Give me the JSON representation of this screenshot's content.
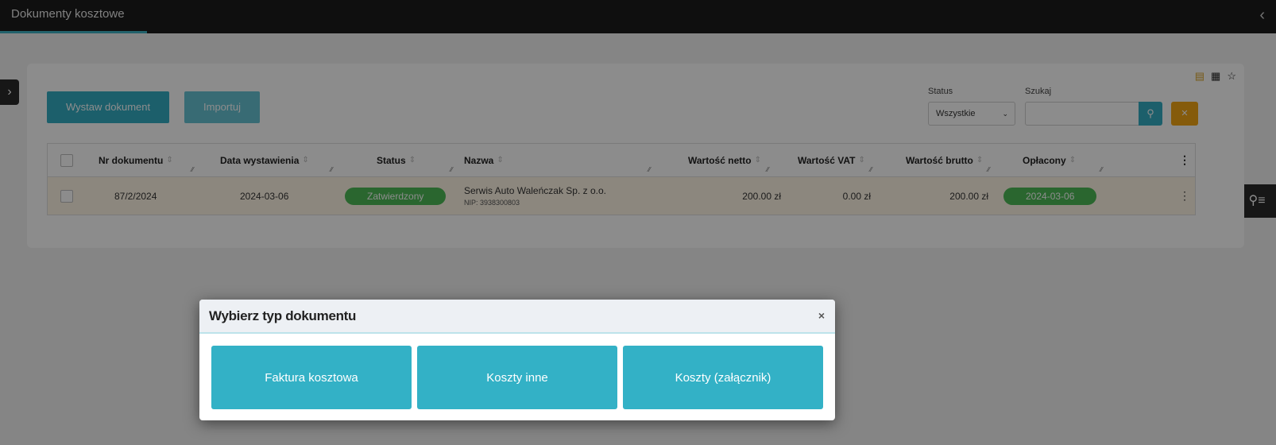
{
  "header": {
    "title": "Dokumenty kosztowe",
    "collapse_icon": "chevron-left-icon",
    "progress_color": "#3fb3c4"
  },
  "sidebar_toggle": {
    "icon": "chevron-right-icon"
  },
  "filter_panel": {
    "icon": "filter-list-icon"
  },
  "view_icons": [
    "list-view-icon",
    "grid-view-icon",
    "star-icon"
  ],
  "toolbar": {
    "create_label": "Wystaw dokument",
    "import_label": "Importuj",
    "status_label": "Status",
    "status_value": "Wszystkie",
    "search_label": "Szukaj",
    "search_value": ""
  },
  "table": {
    "columns": [
      "Nr dokumentu",
      "Data wystawienia",
      "Status",
      "Nazwa",
      "Wartość netto",
      "Wartość VAT",
      "Wartość brutto",
      "Opłacony"
    ],
    "rows": [
      {
        "nr": "87/2/2024",
        "date": "2024-03-06",
        "status": "Zatwierdzony",
        "name": "Serwis Auto Waleńczak Sp. z o.o.",
        "nip": "NIP: 3938300803",
        "netto": "200.00 zł",
        "vat": "0.00 zł",
        "brutto": "200.00 zł",
        "paid": "2024-03-06"
      }
    ]
  },
  "modal": {
    "title": "Wybierz typ dokumentu",
    "close_symbol": "×",
    "options": [
      "Faktura kosztowa",
      "Koszty inne",
      "Koszty (załącznik)"
    ]
  },
  "colors": {
    "accent": "#33aec4",
    "warning": "#f3a715",
    "success": "#4dba56",
    "topbar": "#1c1c1c"
  }
}
